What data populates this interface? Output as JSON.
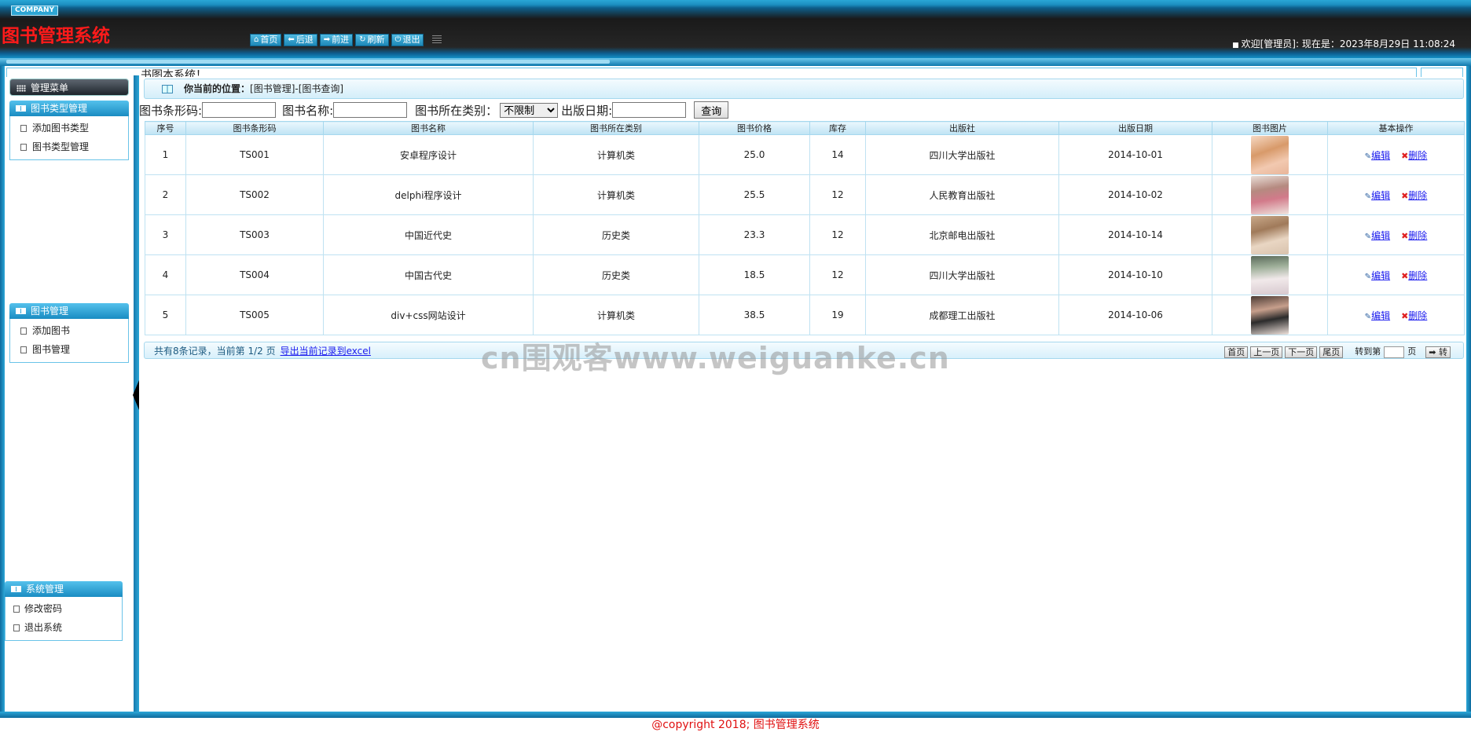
{
  "header": {
    "company": "COMPANY",
    "title": "图书管理系统",
    "nav": [
      {
        "icon": "home-icon",
        "glyph": "⌂",
        "label": "首页"
      },
      {
        "icon": "back-icon",
        "glyph": "⬅",
        "label": "后退"
      },
      {
        "icon": "forward-icon",
        "glyph": "➡",
        "label": "前进"
      },
      {
        "icon": "refresh-icon",
        "glyph": "↻",
        "label": "刷新"
      },
      {
        "icon": "power-icon",
        "glyph": "⏻",
        "label": "退出"
      }
    ],
    "welcome": "欢迎[管理员]:  现在是：2023年8月29日 11:08:24"
  },
  "topline_text": "书图本系统！",
  "sidebar": {
    "menu_title": "管理菜单",
    "groups": [
      {
        "title": "图书类型管理",
        "items": [
          "添加图书类型",
          "图书类型管理"
        ]
      },
      {
        "title": "图书管理",
        "items": [
          "添加图书",
          "图书管理"
        ]
      },
      {
        "title": "系统管理",
        "items": [
          "修改密码",
          "退出系统"
        ]
      }
    ]
  },
  "breadcrumb": {
    "label": "你当前的位置：",
    "path": "[图书管理]-[图书查询]"
  },
  "search": {
    "barcode_label": "图书条形码:",
    "name_label": "图书名称:",
    "category_label": "图书所在类别：",
    "category_value": "不限制",
    "date_label": "出版日期:",
    "button": "查询"
  },
  "table": {
    "headers": [
      "序号",
      "图书条形码",
      "图书名称",
      "图书所在类别",
      "图书价格",
      "库存",
      "出版社",
      "出版日期",
      "图书图片",
      "基本操作"
    ],
    "rows": [
      {
        "no": "1",
        "barcode": "TS001",
        "name": "安卓程序设计",
        "category": "计算机类",
        "price": "25.0",
        "stock": "14",
        "publisher": "四川大学出版社",
        "date": "2014-10-01"
      },
      {
        "no": "2",
        "barcode": "TS002",
        "name": "delphi程序设计",
        "category": "计算机类",
        "price": "25.5",
        "stock": "12",
        "publisher": "人民教育出版社",
        "date": "2014-10-02"
      },
      {
        "no": "3",
        "barcode": "TS003",
        "name": "中国近代史",
        "category": "历史类",
        "price": "23.3",
        "stock": "12",
        "publisher": "北京邮电出版社",
        "date": "2014-10-14"
      },
      {
        "no": "4",
        "barcode": "TS004",
        "name": "中国古代史",
        "category": "历史类",
        "price": "18.5",
        "stock": "12",
        "publisher": "四川大学出版社",
        "date": "2014-10-10"
      },
      {
        "no": "5",
        "barcode": "TS005",
        "name": "div+css网站设计",
        "category": "计算机类",
        "price": "38.5",
        "stock": "19",
        "publisher": "成都理工出版社",
        "date": "2014-10-06"
      }
    ],
    "edit_label": "编辑",
    "delete_label": "删除"
  },
  "pager": {
    "info": "共有8条记录，当前第 1/2 页",
    "export": "导出当前记录到excel",
    "first": "首页",
    "prev": "上一页",
    "next": "下一页",
    "last": "尾页",
    "goto_label": "转到第",
    "page_unit": "页",
    "go": "➡ 转"
  },
  "watermark": "cn围观客www.weiguanke.cn",
  "footer": "@copyright 2018; 图书管理系统",
  "colors": {
    "title_red": "#ff1a1a",
    "brand_blue": "#1a8cc2",
    "link_blue": "#1a1aee"
  }
}
